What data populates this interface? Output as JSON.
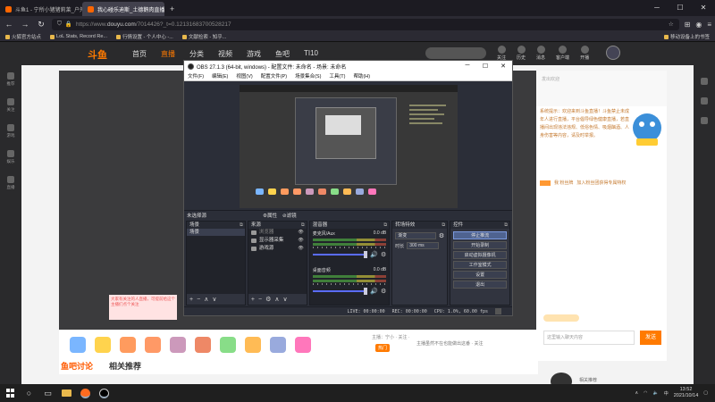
{
  "browser": {
    "tabs": [
      {
        "label": "斗鱼1 - 宁所小猪猪莉莱_户外直播..."
      },
      {
        "label": "我心碰乐迪斯_土德鹅肉直播间..."
      }
    ],
    "url_prefix": "https://www.",
    "url_domain": "douyu.com",
    "url_path": "/7014426?_t=0.12131683700528217",
    "bookmarks": [
      "火狐官方站点",
      "LoL Stats, Record Re...",
      "行情设置 - 个人中心 -...",
      "文献检索 - 知乎..."
    ],
    "bookmarks_right": "移动设备上的书签"
  },
  "site": {
    "logo": "斗鱼",
    "nav": [
      "首页",
      "直播",
      "分类",
      "视频",
      "游戏",
      "鱼吧",
      "TI10"
    ],
    "header_icons": [
      "关注",
      "历史",
      "消息",
      "客户端",
      "开播"
    ],
    "leftbar": [
      "推荐",
      "关注",
      "游戏",
      "娱乐",
      "直播"
    ],
    "under_text": "主播：宁小 · 关注 ·",
    "under_text2": "主播虽然不在也能做出这番 · 关注",
    "promo_text": "大家有关注的人直播，可提前给这个主播们点个关注",
    "hot_btn": "热门",
    "bottom_tabs": [
      "鱼吧讨论",
      "相关推荐"
    ],
    "chat": {
      "top": "发出欢迎",
      "notice": "系统提示：欢迎来到斗鱼直播！斗鱼禁止未成年人进行直播，平台倡导绿色健康直播，若直播间出现违法违规、低俗色情、吸烟酗酒、人身伤害等内容，请及时举报。",
      "fans": "我 粉丝牌",
      "fans_text": "加入粉丝团获得专属特权",
      "input_placeholder": "这里输入聊天内容",
      "send": "发送"
    },
    "recommend_text": "相关推荐"
  },
  "obs": {
    "title": "OBS 27.1.3 (64-bit, windows) - 配置文件: 未命名 - 场景: 未命名",
    "menu": [
      "文件(F)",
      "编辑(E)",
      "视图(V)",
      "配置文件(P)",
      "场景集合(S)",
      "工具(T)",
      "帮助(H)"
    ],
    "no_source": "未选择源",
    "properties": "属性",
    "filters": "滤镜",
    "docks": {
      "scenes": "场景",
      "sources": "来源",
      "mixer": "混音器",
      "transitions": "转场特效",
      "controls": "控件"
    },
    "scene_items": [
      "场景"
    ],
    "source_items": [
      "浏览器",
      "显示器采集",
      "游戏源"
    ],
    "mixer_channels": [
      {
        "name": "麦克风/Aux",
        "db": "0.0 dB"
      },
      {
        "name": "桌面音频",
        "db": "0.0 dB"
      }
    ],
    "transition": {
      "selected": "渐变",
      "duration_label": "时长",
      "duration": "300 ms"
    },
    "controls": [
      {
        "label": "停止推流",
        "active": true
      },
      {
        "label": "开始录制",
        "active": false
      },
      {
        "label": "启动虚拟摄像机",
        "active": false
      },
      {
        "label": "工作室模式",
        "active": false
      },
      {
        "label": "设置",
        "active": false
      },
      {
        "label": "退出",
        "active": false
      }
    ],
    "status": {
      "live": "LIVE: 00:00:00",
      "rec": "REC: 00:00:00",
      "cpu": "CPU: 1.0%, 60.00 fps"
    }
  },
  "taskbar": {
    "time": "13:52",
    "date": "2021/10/14"
  },
  "colors": {
    "accent": "#ff7a00",
    "obs_bg": "#2b2e38"
  }
}
